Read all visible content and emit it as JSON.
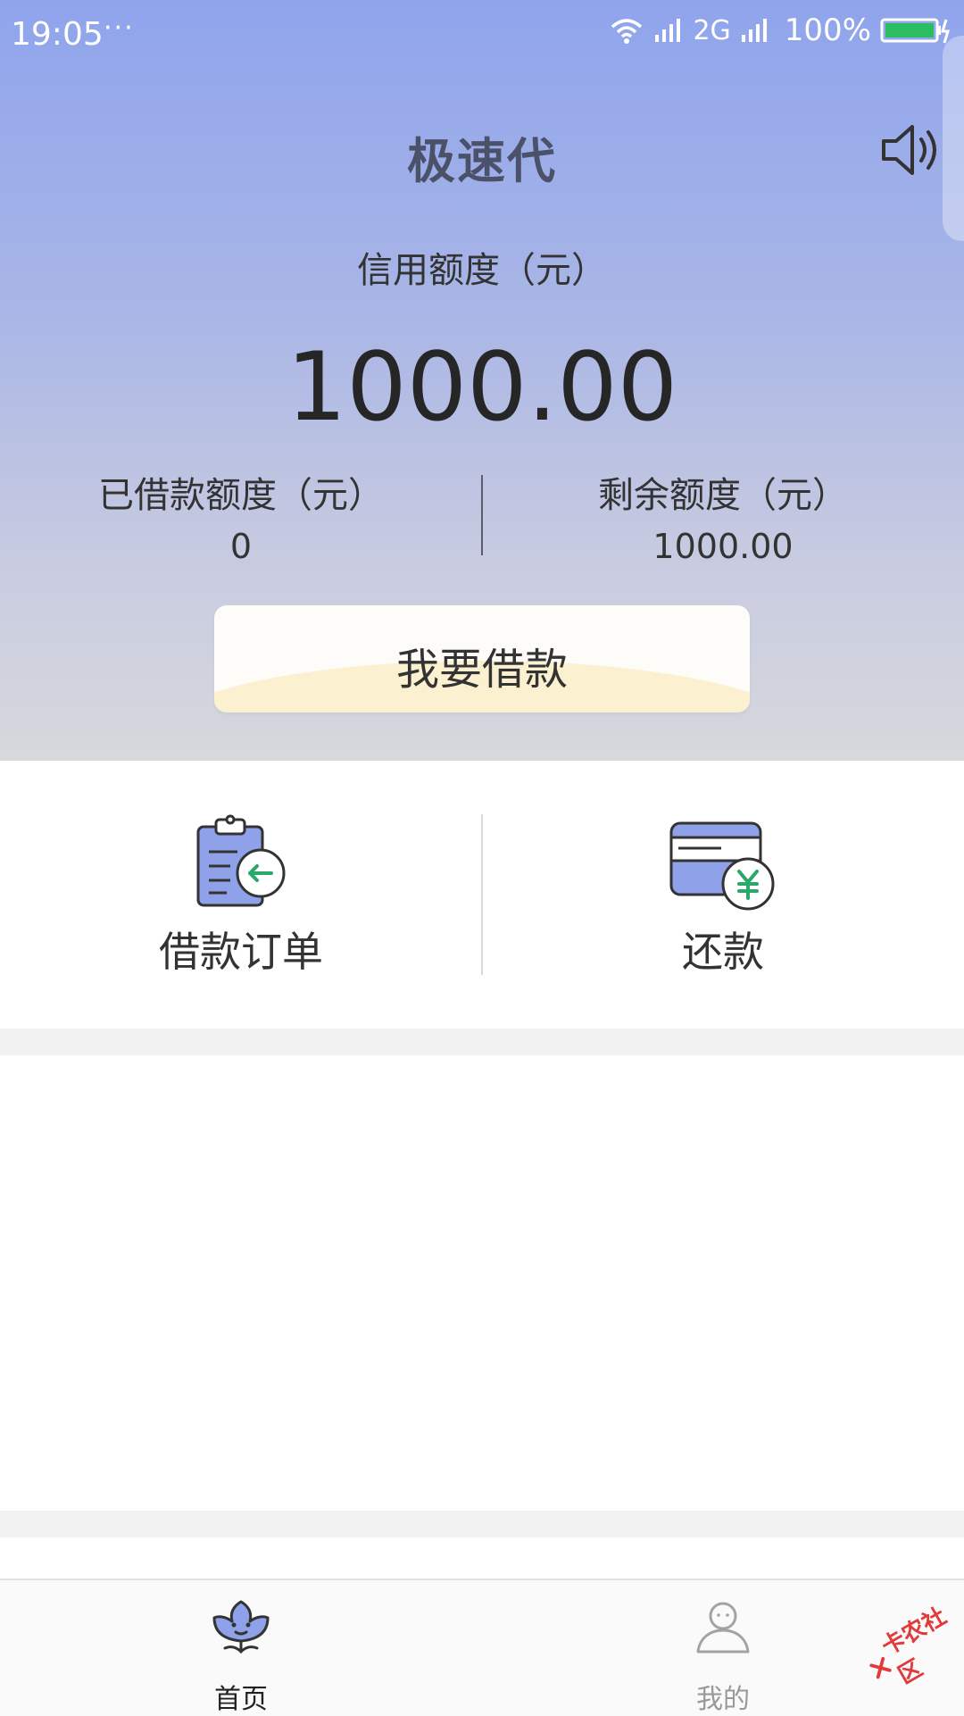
{
  "status_bar": {
    "time": "19:05",
    "dots": "···",
    "network": "2G",
    "battery": "100%"
  },
  "header": {
    "title": "极速代",
    "sound_icon": "speaker-icon"
  },
  "credit": {
    "label": "信用额度（元）",
    "amount": "1000.00"
  },
  "stats": {
    "borrowed_label": "已借款额度（元）",
    "borrowed_value": "0",
    "remaining_label": "剩余额度（元）",
    "remaining_value": "1000.00"
  },
  "borrow_button": {
    "label": "我要借款"
  },
  "actions": [
    {
      "label": "借款订单",
      "icon": "clipboard-icon"
    },
    {
      "label": "还款",
      "icon": "card-yuan-icon"
    }
  ],
  "tabs": [
    {
      "label": "首页",
      "icon": "home-flower-icon",
      "active": true
    },
    {
      "label": "我的",
      "icon": "user-icon",
      "active": false
    }
  ],
  "watermark": {
    "text": "卡农社区"
  },
  "colors": {
    "accent": "#8fa4ec",
    "icon_fill": "#8fa1e8",
    "icon_stroke": "#333333",
    "green": "#2aa76a",
    "button_arc": "#fbf0cf"
  }
}
